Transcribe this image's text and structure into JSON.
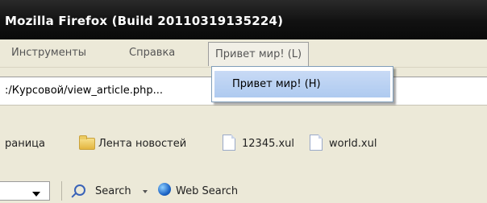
{
  "window": {
    "title": "Mozilla Firefox (Build 20110319135224)"
  },
  "menubar": {
    "items": [
      {
        "label": "Инструменты"
      },
      {
        "label": "Справка"
      },
      {
        "label": "Привет мир! (L)"
      }
    ]
  },
  "popup_menu": {
    "items": [
      {
        "label": "Привет мир! (H)"
      }
    ]
  },
  "urlbar": {
    "value": ":/Курсовой/view_article.php..."
  },
  "bookmarks": {
    "items": [
      {
        "label": "раница",
        "icon": "none"
      },
      {
        "label": "Лента новостей",
        "icon": "folder-icon"
      },
      {
        "label": "12345.xul",
        "icon": "file-icon"
      },
      {
        "label": "world.xul",
        "icon": "file-icon"
      }
    ]
  },
  "searchbar": {
    "search_label": "Search",
    "web_search_label": "Web Search"
  }
}
